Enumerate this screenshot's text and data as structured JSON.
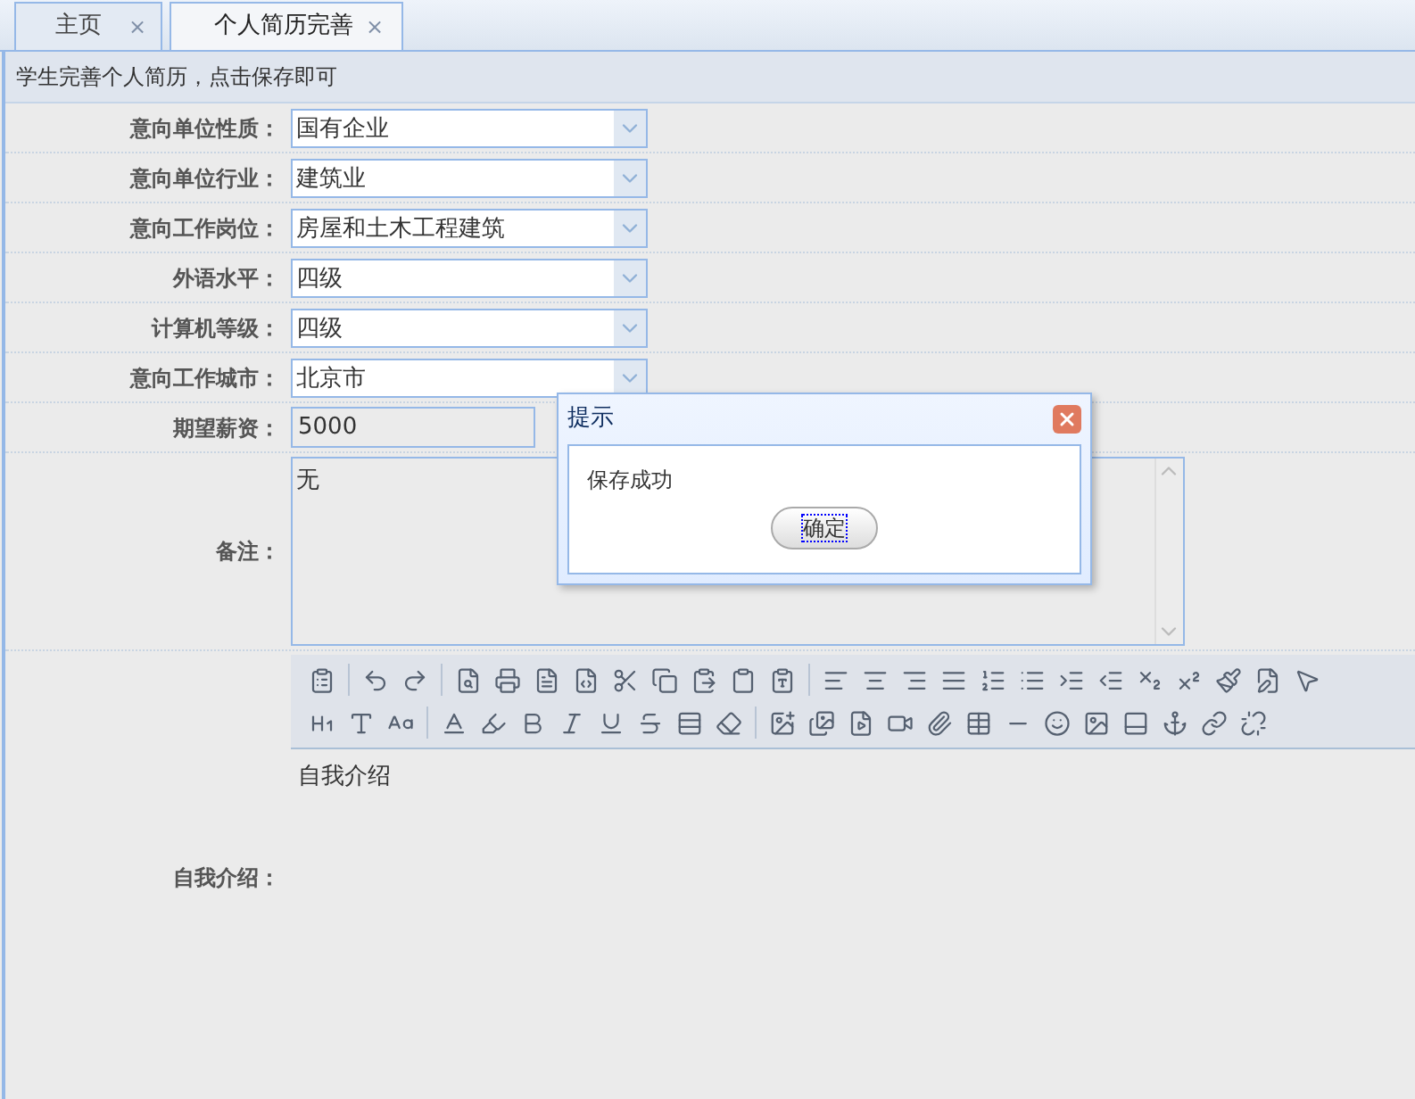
{
  "tabs": [
    {
      "label": "主页",
      "selected": false,
      "close": "×"
    },
    {
      "label": "个人简历完善",
      "selected": true,
      "close": "×"
    }
  ],
  "header": {
    "text": "学生完善个人简历，点击保存即可"
  },
  "form": {
    "fields": [
      {
        "kind": "select",
        "label": "意向单位性质：",
        "value": "国有企业"
      },
      {
        "kind": "select",
        "label": "意向单位行业：",
        "value": "建筑业"
      },
      {
        "kind": "select",
        "label": "意向工作岗位：",
        "value": "房屋和土木工程建筑"
      },
      {
        "kind": "select",
        "label": "外语水平：",
        "value": "四级"
      },
      {
        "kind": "select",
        "label": "计算机等级：",
        "value": "四级"
      },
      {
        "kind": "select",
        "label": "意向工作城市：",
        "value": "北京市"
      },
      {
        "kind": "input",
        "label": "期望薪资：",
        "value": "5000"
      },
      {
        "kind": "textarea",
        "label": "备注：",
        "value": "无"
      },
      {
        "kind": "editor",
        "label": "自我介绍：",
        "value": "自我介绍"
      }
    ]
  },
  "dialog": {
    "title": "提示",
    "message": "保存成功",
    "button": "确定"
  }
}
